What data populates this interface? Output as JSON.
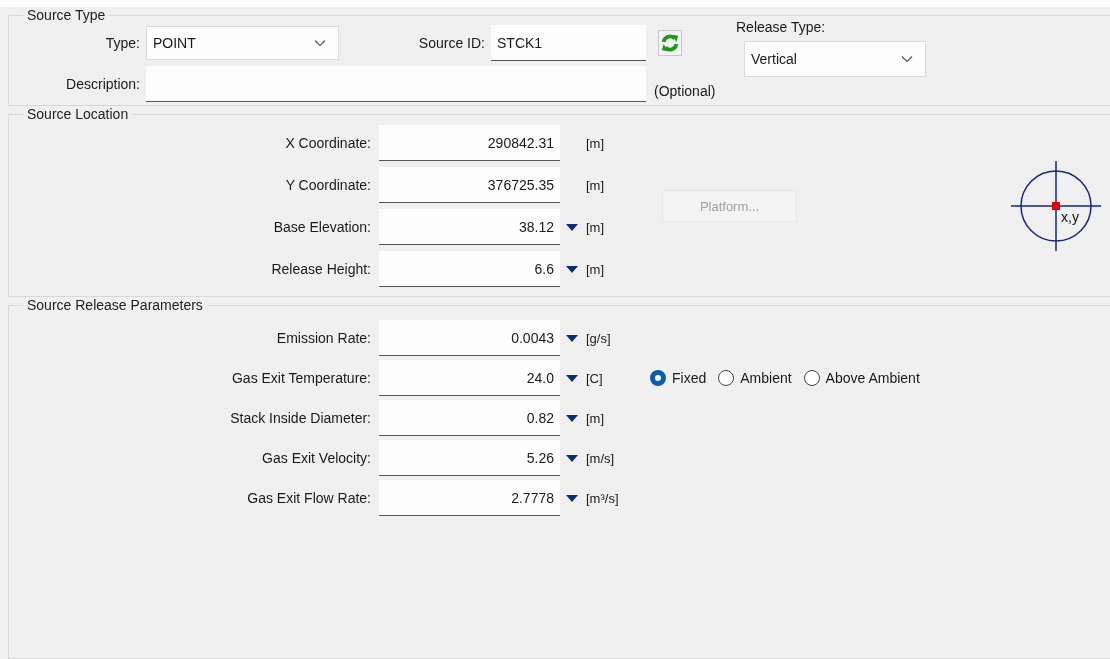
{
  "source_type": {
    "title": "Source Type",
    "type": {
      "label": "Type:",
      "value": "POINT"
    },
    "source_id": {
      "label": "Source ID:",
      "value": "STCK1"
    },
    "release_type": {
      "label": "Release Type:",
      "value": "Vertical"
    },
    "description": {
      "label": "Description:",
      "note": "(Optional)"
    }
  },
  "source_location": {
    "title": "Source Location",
    "fields": [
      {
        "label": "X Coordinate:",
        "value": "290842.31",
        "unit": "[m]",
        "has_dropdown": false
      },
      {
        "label": "Y Coordinate:",
        "value": "376725.35",
        "unit": "[m]",
        "has_dropdown": false
      },
      {
        "label": "Base Elevation:",
        "value": "38.12",
        "unit": "[m]",
        "has_dropdown": true
      },
      {
        "label": "Release Height:",
        "value": "6.6",
        "unit": "[m]",
        "has_dropdown": true
      }
    ],
    "platform_button": {
      "label": "Platform...",
      "disabled": true
    },
    "marker_label": "x,y"
  },
  "release_parameters": {
    "title": "Source Release Parameters",
    "fields": [
      {
        "label": "Emission Rate:",
        "value": "0.0043",
        "unit": "[g/s]",
        "has_dropdown": true
      },
      {
        "label": "Gas Exit Temperature:",
        "value": "24.0",
        "unit": "[C]",
        "has_dropdown": true,
        "options": [
          {
            "label": "Fixed",
            "selected": true
          },
          {
            "label": "Ambient",
            "selected": false
          },
          {
            "label": "Above Ambient",
            "selected": false
          }
        ]
      },
      {
        "label": "Stack Inside Diameter:",
        "value": "0.82",
        "unit": "[m]",
        "has_dropdown": true
      },
      {
        "label": "Gas Exit Velocity:",
        "value": "5.26",
        "unit": "[m/s]",
        "has_dropdown": true
      },
      {
        "label": "Gas Exit Flow Rate:",
        "value": "2.7778",
        "unit": "[m³/s]",
        "has_dropdown": true
      }
    ]
  }
}
